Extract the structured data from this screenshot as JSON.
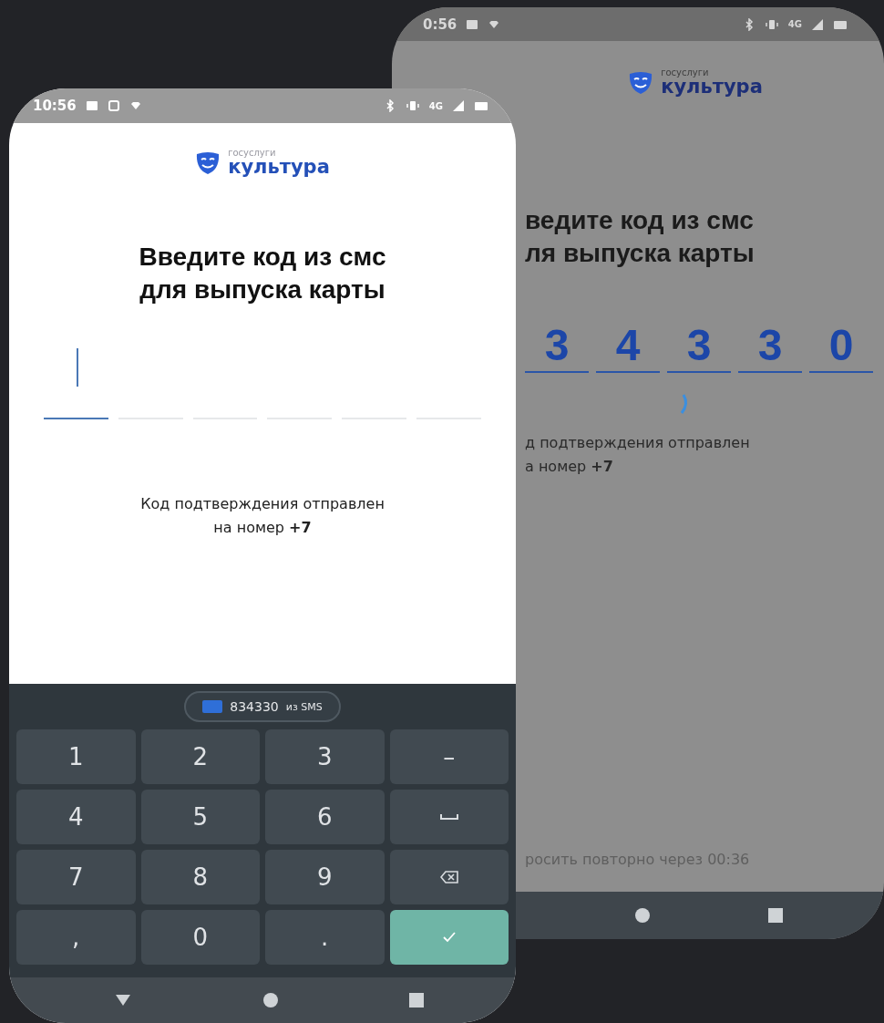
{
  "back_phone": {
    "status_bar": {
      "time": "0:56",
      "network": "4G"
    },
    "logo": {
      "caption": "госуслуги",
      "name": "культура"
    },
    "title_lines": [
      "ведите код из смс",
      "ля выпуска карты"
    ],
    "code_cells": [
      {
        "digit": "3"
      },
      {
        "digit": "4"
      },
      {
        "digit": "3"
      },
      {
        "digit": "3"
      },
      {
        "digit": "0"
      }
    ],
    "message_lines": [
      "д подтверждения отправлен",
      "а номер **+7**"
    ],
    "resend": "росить повторно через 00:36"
  },
  "front_phone": {
    "status_bar": {
      "time": "10:56",
      "network": "4G"
    },
    "logo": {
      "caption": "госуслуги",
      "name": "культура"
    },
    "title_lines": [
      "Введите код из смс",
      "для выпуска карты"
    ],
    "code_cells": [
      {
        "focused": true
      },
      {
        "focused": false
      },
      {
        "focused": false
      },
      {
        "focused": false
      },
      {
        "focused": false
      },
      {
        "focused": false
      }
    ],
    "message_lines": [
      "Код подтверждения отправлен",
      "на номер **+7**"
    ],
    "keyboard": {
      "suggestion": {
        "code": "834330",
        "source": "из SMS"
      },
      "keys": [
        {
          "kind": "text",
          "label": "1"
        },
        {
          "kind": "text",
          "label": "2"
        },
        {
          "kind": "text",
          "label": "3"
        },
        {
          "kind": "text",
          "label": "–"
        },
        {
          "kind": "text",
          "label": "4"
        },
        {
          "kind": "text",
          "label": "5"
        },
        {
          "kind": "text",
          "label": "6"
        },
        {
          "kind": "space"
        },
        {
          "kind": "text",
          "label": "7"
        },
        {
          "kind": "text",
          "label": "8"
        },
        {
          "kind": "text",
          "label": "9"
        },
        {
          "kind": "backspace"
        },
        {
          "kind": "text",
          "label": ","
        },
        {
          "kind": "text",
          "label": "0"
        },
        {
          "kind": "text",
          "label": "."
        },
        {
          "kind": "enter"
        }
      ]
    }
  }
}
